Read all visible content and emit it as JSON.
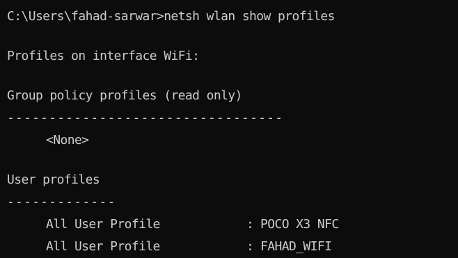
{
  "terminal": {
    "command_line": "C:\\Users\\fahad-sarwar>netsh wlan show profiles",
    "interface_heading": "Profiles on interface WiFi:",
    "group_heading": "Group policy profiles (read only)",
    "group_rule": "---------------------------------",
    "group_none": "<None>",
    "user_heading": "User profiles",
    "user_rule": "-------------",
    "profiles": [
      {
        "label": "All User Profile",
        "sep": ":",
        "name": "POCO X3 NFC"
      },
      {
        "label": "All User Profile",
        "sep": ":",
        "name": "FAHAD_WIFI"
      }
    ]
  }
}
